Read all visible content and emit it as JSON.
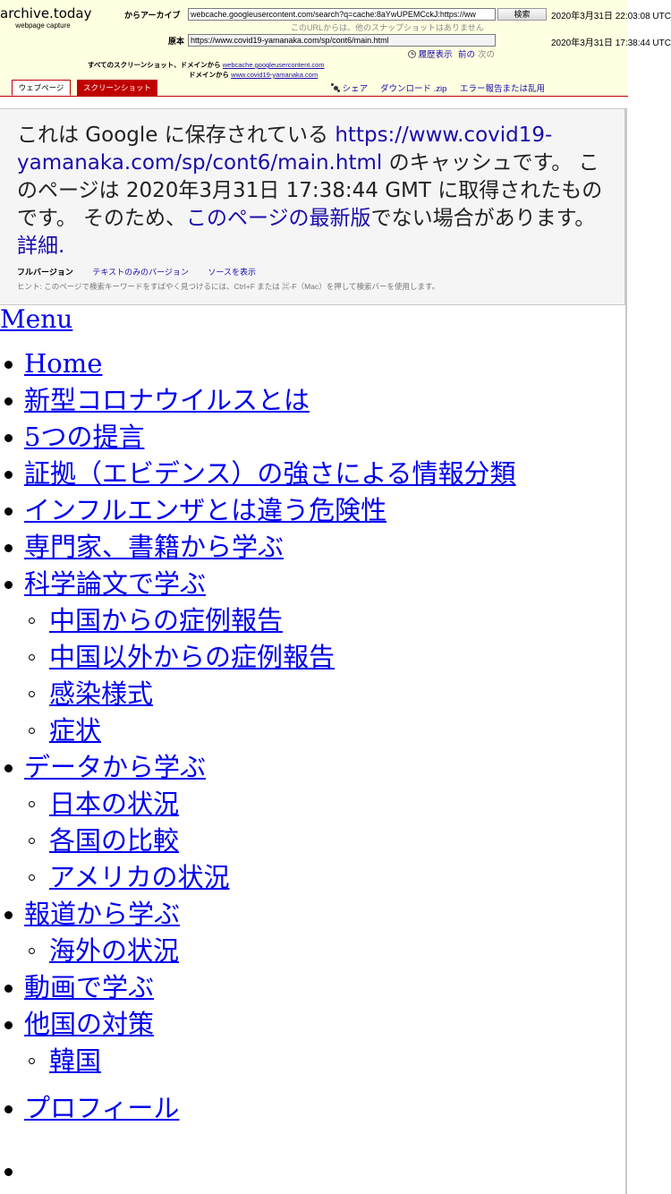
{
  "archive": {
    "brand_title": "archive.today",
    "brand_subtitle": "webpage capture",
    "archive_from_label": "からアーカイブ",
    "archive_from_url": "webcache.googleusercontent.com/search?q=cache:8aYwUPEMCckJ:https://ww",
    "search_button": "検索",
    "archived_timestamp": "2020年3月31日 22:03:08 UTC",
    "no_other_snapshots": "このURLからは、他のスナップショットはありません",
    "original_label": "原本",
    "original_url": "https://www.covid19-yamanaka.com/sp/cont6/main.html",
    "original_timestamp": "2020年3月31日 17:38:44 UTC",
    "history_label": "履歴表示",
    "prev_label": "前の",
    "next_label": "次の",
    "all_screenshots_label": "すべてのスクリーンショット、ドメインから",
    "all_screenshots_domain": "webcache.googleusercontent.com",
    "from_domain_label": "ドメインから",
    "from_domain_value": "www.covid19-yamanaka.com",
    "tab_webpage": "ウェブページ",
    "tab_screenshot": "スクリーンショット",
    "share_label": "シェア",
    "download_label": "ダウンロード .zip",
    "report_label": "エラー報告または乱用"
  },
  "cache": {
    "intro": "これは Google に保存されている ",
    "url": "https://www.covid19-yamanaka.com/sp/cont6/main.html",
    "cache_suffix": " のキャッシュです。 このページは 2020年3月31日 17:38:44 GMT に取得されたものです。 そのため、",
    "latest_link": "このページの最新版",
    "not_latest": "でない場合があります。",
    "details_link": "詳細.",
    "full_version": "フルバージョン",
    "text_only": "テキストのみのバージョン",
    "view_source": "ソースを表示",
    "hint": "ヒント: このページで検索キーワードをすばやく見つけるには、Ctrl+F または ⌘-F（Mac）を押して検索バーを使用します。"
  },
  "nav": {
    "menu": "Menu",
    "items": [
      {
        "label": "Home",
        "level": 0
      },
      {
        "label": "新型コロナウイルスとは",
        "level": 0
      },
      {
        "label": "5つの提言",
        "level": 0
      },
      {
        "label": "証拠（エビデンス）の強さによる情報分類",
        "level": 0
      },
      {
        "label": "インフルエンザとは違う危険性",
        "level": 0
      },
      {
        "label": "専門家、書籍から学ぶ",
        "level": 0
      },
      {
        "label": "科学論文で学ぶ",
        "level": 0
      },
      {
        "label": "中国からの症例報告",
        "level": 1
      },
      {
        "label": "中国以外からの症例報告",
        "level": 1
      },
      {
        "label": "感染様式",
        "level": 1
      },
      {
        "label": "症状",
        "level": 1
      },
      {
        "label": "データから学ぶ",
        "level": 0
      },
      {
        "label": "日本の状況",
        "level": 1
      },
      {
        "label": "各国の比較",
        "level": 1
      },
      {
        "label": "アメリカの状況",
        "level": 1
      },
      {
        "label": "報道から学ぶ",
        "level": 0
      },
      {
        "label": "海外の状況",
        "level": 1
      },
      {
        "label": "動画で学ぶ",
        "level": 0
      },
      {
        "label": "他国の対策",
        "level": 0
      },
      {
        "label": "韓国",
        "level": 1
      },
      {
        "label": "プロフィール",
        "level": 0
      }
    ]
  },
  "colors": {
    "header_bg": "#ffffe1",
    "accent_red": "#c00000",
    "link_blue": "#0000ee",
    "google_link": "#1a0dab"
  }
}
